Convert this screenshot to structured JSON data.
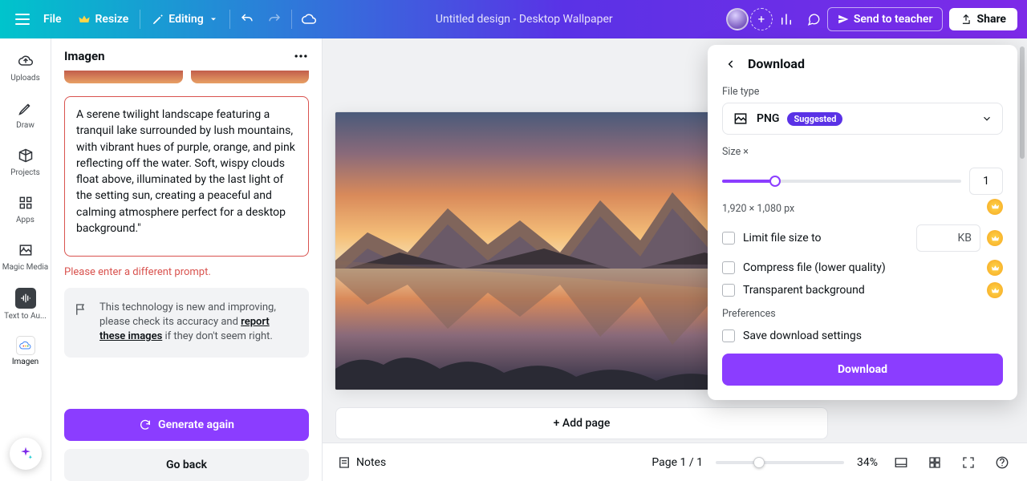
{
  "topbar": {
    "file": "File",
    "resize": "Resize",
    "editing": "Editing",
    "title": "Untitled design - Desktop Wallpaper",
    "send": "Send to teacher",
    "share": "Share"
  },
  "rail": {
    "uploads": "Uploads",
    "draw": "Draw",
    "projects": "Projects",
    "apps": "Apps",
    "magic_media": "Magic Media",
    "text_to_au": "Text to Au...",
    "imagen": "Imagen"
  },
  "panel": {
    "title": "Imagen",
    "prompt": "A serene twilight landscape featuring a tranquil lake surrounded by lush mountains, with vibrant hues of purple, orange, and pink reflecting off the water. Soft, wispy clouds float above, illuminated by the last light of the setting sun, creating a peaceful and calming atmosphere perfect for a desktop background.\"",
    "error": "Please enter a different prompt.",
    "notice_a": "This technology is new and improving, please check its accuracy and ",
    "notice_link": "report these images",
    "notice_b": " if they don't seem right.",
    "generate": "Generate again",
    "goback": "Go back"
  },
  "canvas": {
    "add_page": "+ Add page"
  },
  "bottombar": {
    "notes": "Notes",
    "page": "Page 1 / 1",
    "zoom": "34%"
  },
  "popover": {
    "title": "Download",
    "file_type_label": "File type",
    "file_type_value": "PNG",
    "suggested": "Suggested",
    "size_label": "Size ×",
    "size_value": "1",
    "dimensions": "1,920 × 1,080 px",
    "limit": "Limit file size to",
    "kb": "KB",
    "compress": "Compress file (lower quality)",
    "transparent": "Transparent background",
    "preferences": "Preferences",
    "save_settings": "Save download settings",
    "download": "Download"
  }
}
